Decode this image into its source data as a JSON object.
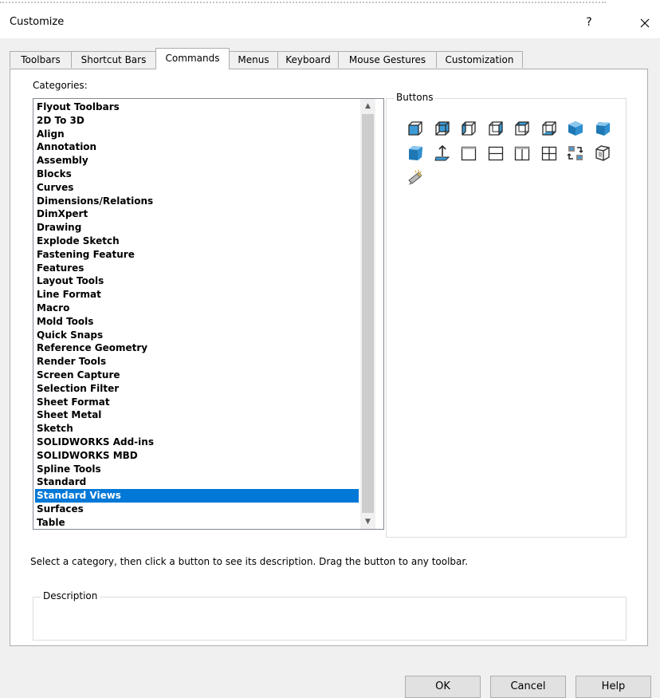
{
  "dialog": {
    "title": "Customize",
    "help_glyph": "?"
  },
  "tabs": [
    {
      "label": "Toolbars"
    },
    {
      "label": "Shortcut Bars"
    },
    {
      "label": "Commands",
      "active": true
    },
    {
      "label": "Menus"
    },
    {
      "label": "Keyboard"
    },
    {
      "label": "Mouse Gestures"
    },
    {
      "label": "Customization"
    }
  ],
  "categories": {
    "label": "Categories:",
    "selected": "Standard Views",
    "items": [
      "Flyout Toolbars",
      "2D To 3D",
      "Align",
      "Annotation",
      "Assembly",
      "Blocks",
      "Curves",
      "Dimensions/Relations",
      "DimXpert",
      "Drawing",
      "Explode Sketch",
      "Fastening Feature",
      "Features",
      "Layout Tools",
      "Line Format",
      "Macro",
      "Mold Tools",
      "Quick Snaps",
      "Reference Geometry",
      "Render Tools",
      "Screen Capture",
      "Selection Filter",
      "Sheet Format",
      "Sheet Metal",
      "Sketch",
      "SOLIDWORKS Add-ins",
      "SOLIDWORKS MBD",
      "Spline Tools",
      "Standard",
      "Standard Views",
      "Surfaces",
      "Table"
    ]
  },
  "buttons_panel": {
    "label": "Buttons",
    "icons": [
      "front-view-icon",
      "back-view-icon",
      "left-view-icon",
      "right-view-icon",
      "top-view-icon",
      "bottom-view-icon",
      "isometric-view-icon",
      "trimetric-view-icon",
      "dimetric-view-icon",
      "normal-to-icon",
      "single-view-icon",
      "two-view-horizontal-icon",
      "two-view-vertical-icon",
      "four-view-icon",
      "link-views-icon",
      "3d-drawing-view-icon",
      "view-selector-icon"
    ]
  },
  "instruction": "Select a category, then click a button to see its description. Drag the button to any toolbar.",
  "description": {
    "label": "Description",
    "text": ""
  },
  "footer": {
    "ok": "OK",
    "cancel": "Cancel",
    "help": "Help"
  },
  "colors": {
    "selection": "#0078d7",
    "dialog_bg": "#f0f0f0",
    "icon_blue": "#3d9bd6"
  }
}
